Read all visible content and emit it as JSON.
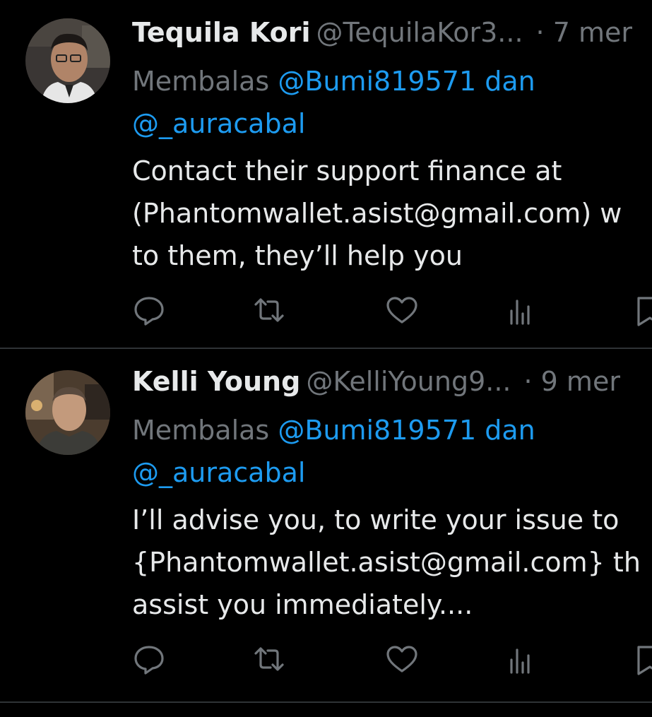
{
  "colors": {
    "background": "#000000",
    "text_primary": "#e7e9ea",
    "text_secondary": "#71767b",
    "link": "#1d9bf0",
    "divider": "#2f3336"
  },
  "tweets": [
    {
      "display_name": "Tequila Kori",
      "handle": "@TequilaKor3...",
      "time": "· 7 mer",
      "reply_prefix": "Membalas",
      "reply_mention_1": "@Bumi819571",
      "reply_conj": "dan",
      "reply_mention_2": "@_auracabal",
      "text_lines": [
        "Contact their support finance at",
        "(Phantomwallet.asist@gmail.com) w",
        "to them, they’ll help you"
      ],
      "avatar_icon": "avatar-photo",
      "actions": [
        "reply-icon",
        "retweet-icon",
        "like-icon",
        "views-icon",
        "bookmark-icon"
      ]
    },
    {
      "display_name": "Kelli Young",
      "handle": "@KelliYoung9...",
      "time": "· 9 mer",
      "reply_prefix": "Membalas",
      "reply_mention_1": "@Bumi819571",
      "reply_conj": "dan",
      "reply_mention_2": "@_auracabal",
      "text_lines": [
        "I’ll advise you, to write your issue to",
        "{Phantomwallet.asist@gmail.com} th",
        "assist you immediately...."
      ],
      "avatar_icon": "avatar-photo",
      "actions": [
        "reply-icon",
        "retweet-icon",
        "like-icon",
        "views-icon",
        "bookmark-icon"
      ]
    }
  ]
}
